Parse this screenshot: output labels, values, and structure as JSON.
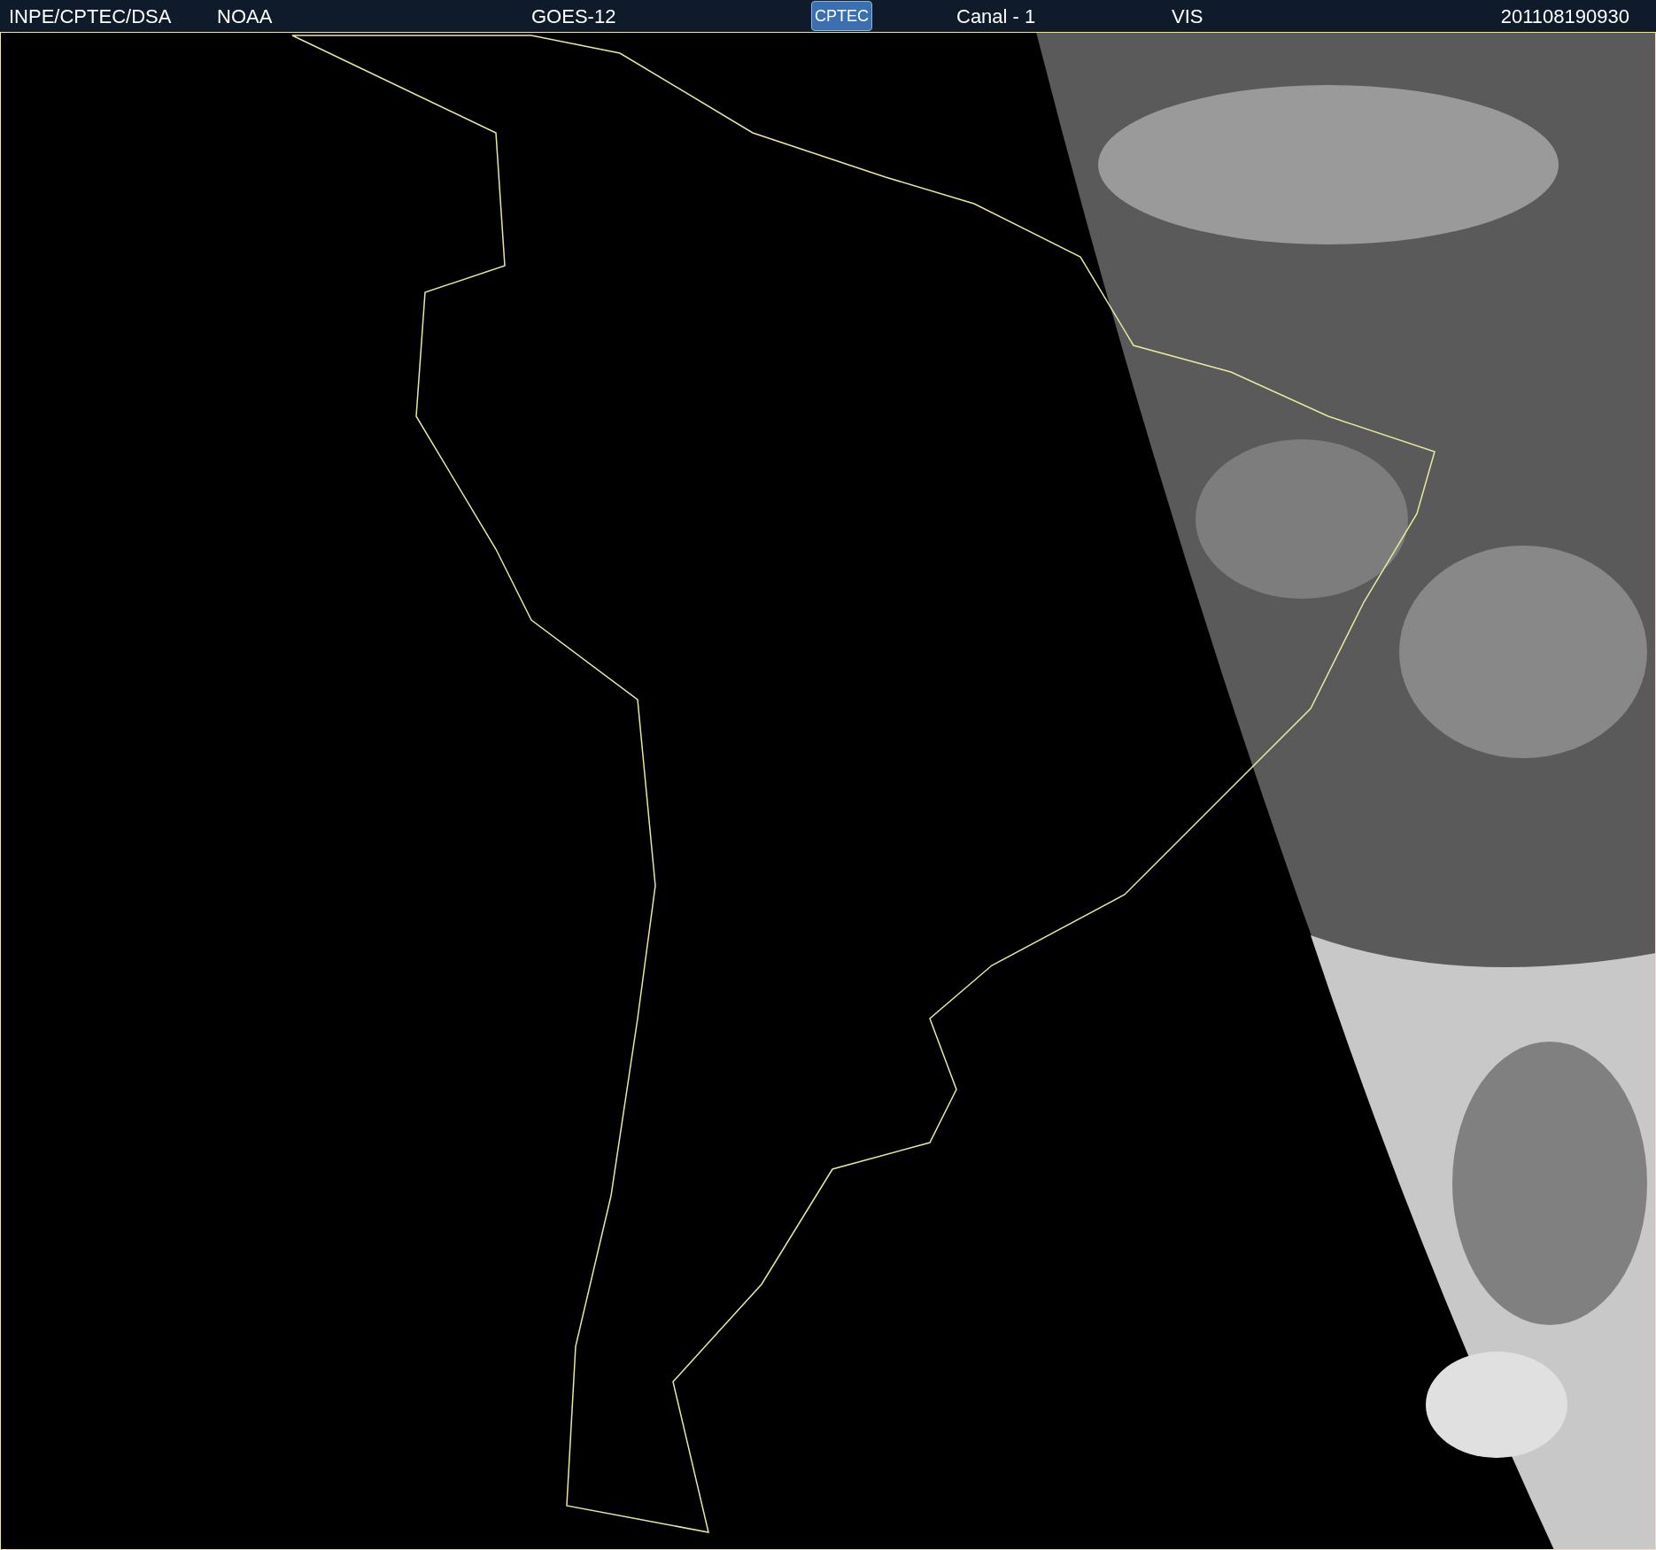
{
  "header": {
    "texts": [
      {
        "text": "INPE/CPTEC/DSA"
      },
      {
        "text": "NOAA"
      },
      {
        "text": "GOES-12"
      }
    ],
    "logo": {
      "text": "CPTEC"
    },
    "texts_right": [
      {
        "text": "Canal - 1"
      },
      {
        "text": "VIS"
      },
      {
        "text": "201108190930"
      }
    ]
  }
}
